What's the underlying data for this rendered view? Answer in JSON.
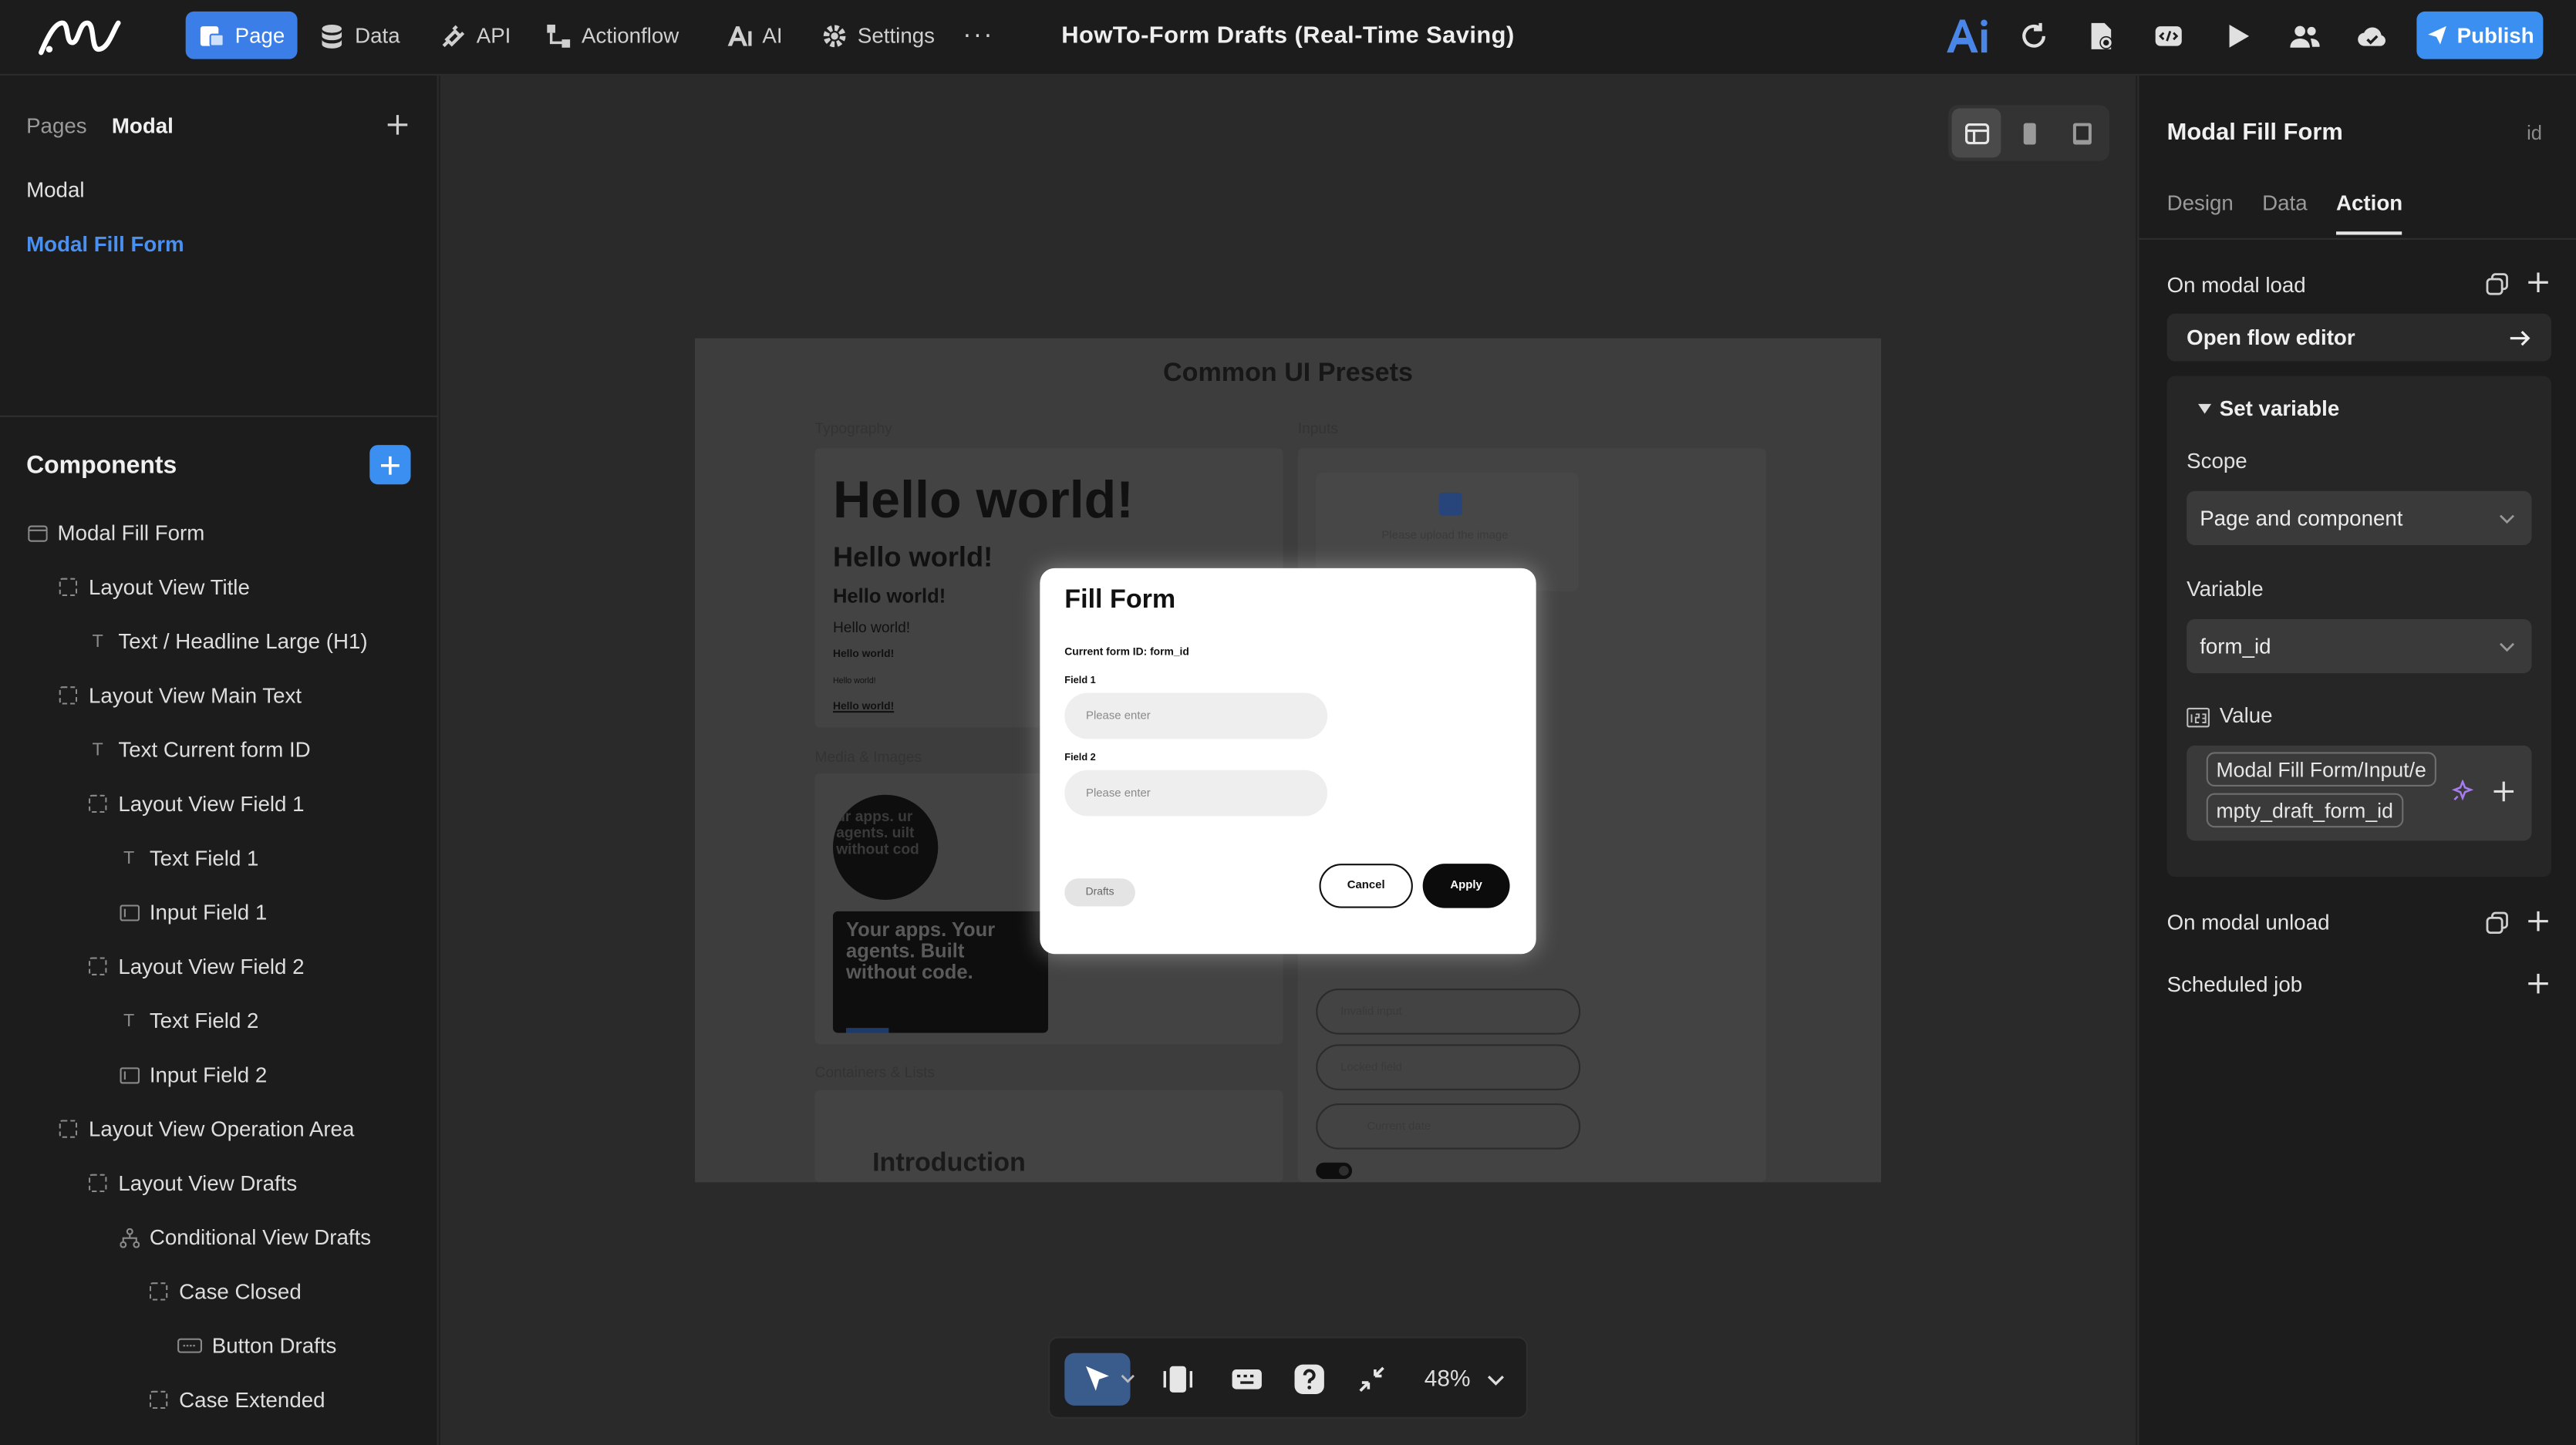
{
  "topbar": {
    "nav": [
      {
        "label": "Page",
        "icon": "page-icon",
        "active": true
      },
      {
        "label": "Data",
        "icon": "database-icon"
      },
      {
        "label": "API",
        "icon": "plug-icon"
      },
      {
        "label": "Actionflow",
        "icon": "flow-icon"
      },
      {
        "label": "AI",
        "icon": "ai-icon"
      },
      {
        "label": "Settings",
        "icon": "gear-icon"
      }
    ],
    "more": "···",
    "title": "HowTo-Form Drafts (Real-Time Saving)",
    "publish_label": "Publish",
    "accent": "#3b8ff0"
  },
  "left_panel": {
    "tabs": [
      "Pages",
      "Modal"
    ],
    "pages": [
      {
        "label": "Modal",
        "selected": false
      },
      {
        "label": "Modal Fill Form",
        "selected": true
      }
    ],
    "components_title": "Components",
    "tree": [
      {
        "label": "Modal Fill Form",
        "icon": "modal-icon",
        "depth": 0
      },
      {
        "label": "Layout View Title",
        "icon": "layout-icon",
        "depth": 1
      },
      {
        "label": "Text / Headline Large (H1)",
        "icon": "text-icon",
        "depth": 2
      },
      {
        "label": "Layout View Main Text",
        "icon": "layout-icon",
        "depth": 1
      },
      {
        "label": "Text Current form ID",
        "icon": "text-icon",
        "depth": 2
      },
      {
        "label": "Layout View Field 1",
        "icon": "layout-icon",
        "depth": 2
      },
      {
        "label": "Text Field 1",
        "icon": "text-icon",
        "depth": 3
      },
      {
        "label": "Input Field 1",
        "icon": "input-icon",
        "depth": 3
      },
      {
        "label": "Layout View Field 2",
        "icon": "layout-icon",
        "depth": 2
      },
      {
        "label": "Text Field 2",
        "icon": "text-icon",
        "depth": 3
      },
      {
        "label": "Input Field 2",
        "icon": "input-icon",
        "depth": 3
      },
      {
        "label": "Layout View Operation Area",
        "icon": "layout-icon",
        "depth": 1
      },
      {
        "label": "Layout View Drafts",
        "icon": "layout-icon",
        "depth": 2
      },
      {
        "label": "Conditional View Drafts",
        "icon": "conditional-icon",
        "depth": 3
      },
      {
        "label": "Case Closed",
        "icon": "layout-icon",
        "depth": 4
      },
      {
        "label": "Button Drafts",
        "icon": "button-icon",
        "depth": 5
      },
      {
        "label": "Case Extended",
        "icon": "layout-icon",
        "depth": 4
      }
    ]
  },
  "canvas": {
    "frame_title": "Common UI Presets",
    "sections": {
      "typography": "Typography",
      "inputs": "Inputs",
      "media": "Media & Images",
      "containers": "Containers & Lists"
    },
    "typography": [
      "Hello world!",
      "Hello world!",
      "Hello world!",
      "Hello world!",
      "Hello world!",
      "Hello world!",
      "Hello world!"
    ],
    "circle_text": "ur apps. ur agents. uilt without cod",
    "banner_text": "Your apps. Your agents. Built without code.",
    "upload_text": "Please upload the image",
    "inputs": [
      "Invalid input",
      "Locked field",
      "Current date"
    ],
    "intro": "Introduction",
    "modal": {
      "title": "Fill Form",
      "subtitle": "Current form ID: form_id",
      "field1_label": "Field 1",
      "field1_placeholder": "Please enter",
      "field2_label": "Field 2",
      "field2_placeholder": "Please enter",
      "drafts": "Drafts",
      "cancel": "Cancel",
      "apply": "Apply"
    },
    "zoom": "48%"
  },
  "right_panel": {
    "title": "Modal Fill Form",
    "id_label": "id",
    "tabs": [
      "Design",
      "Data",
      "Action"
    ],
    "active_tab": "Action",
    "on_load": "On modal load",
    "open_flow": "Open flow editor",
    "set_variable": "Set variable",
    "scope_label": "Scope",
    "scope_value": "Page and component",
    "variable_label": "Variable",
    "variable_value": "form_id",
    "value_label": "Value",
    "value_chip_1": "Modal Fill Form/Input/e",
    "value_chip_2": "mpty_draft_form_id",
    "on_unload": "On modal unload",
    "scheduled": "Scheduled job"
  }
}
